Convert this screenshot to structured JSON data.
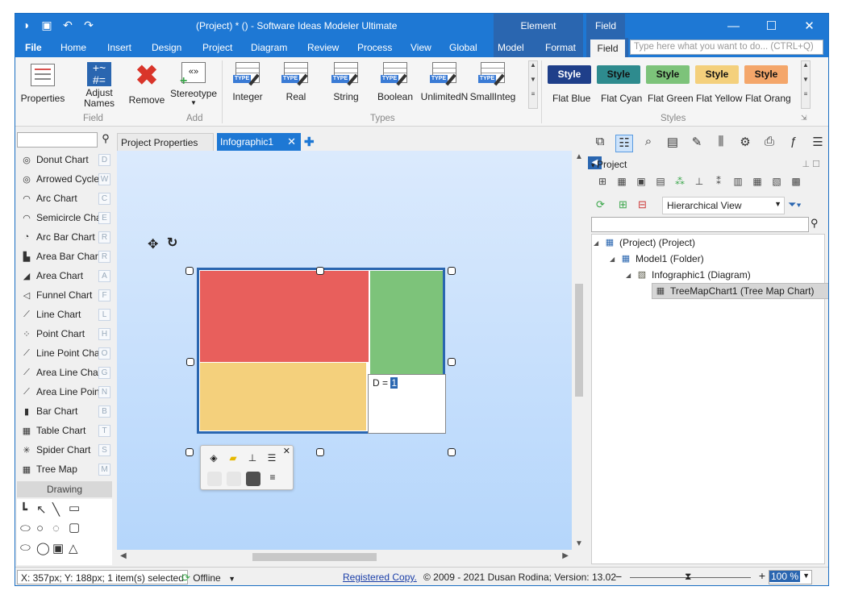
{
  "window": {
    "title": "(Project) *  () - Software Ideas Modeler Ultimate",
    "context_element": "Element",
    "context_field": "Field",
    "minimize": "—",
    "maximize": "☐",
    "close": "✕"
  },
  "menu": {
    "file": "File",
    "items": [
      "Home",
      "Insert",
      "Design",
      "Project",
      "Diagram",
      "Review",
      "Process",
      "View",
      "Global",
      "Model",
      "Format",
      "Field"
    ],
    "search_placeholder": "Type here what you want to do...  (CTRL+Q)"
  },
  "ribbon": {
    "properties": "Properties",
    "adjust_names": "Adjust Names",
    "remove": "Remove",
    "stereotype": "Stereotype",
    "group_field": "Field",
    "group_add": "Add",
    "group_types": "Types",
    "group_styles": "Styles",
    "types": [
      "Integer",
      "Real",
      "String",
      "Boolean",
      "UnlimitedN",
      "SmallInteg"
    ],
    "type_tag": "TYPE",
    "style_btn": "Style",
    "styles": [
      {
        "label": "Flat Blue",
        "bg": "#1f3f8a",
        "fg": "#ffffff"
      },
      {
        "label": "Flat Cyan",
        "bg": "#2e8b8e",
        "fg": "#111111"
      },
      {
        "label": "Flat Green",
        "bg": "#7dc37a",
        "fg": "#111111"
      },
      {
        "label": "Flat Yellow",
        "bg": "#f4d07c",
        "fg": "#111111"
      },
      {
        "label": "Flat Orang",
        "bg": "#f4a66a",
        "fg": "#111111"
      }
    ]
  },
  "toolbox": {
    "items": [
      {
        "label": "Donut Chart",
        "key": "D",
        "icon": "◎"
      },
      {
        "label": "Arrowed Cycle",
        "key": "W",
        "icon": "◎"
      },
      {
        "label": "Arc Chart",
        "key": "C",
        "icon": "◠"
      },
      {
        "label": "Semicircle Chart",
        "key": "E",
        "icon": "◠"
      },
      {
        "label": "Arc Bar Chart",
        "key": "R",
        "icon": "◔"
      },
      {
        "label": "Area Bar Chart",
        "key": "R",
        "icon": "▙"
      },
      {
        "label": "Area Chart",
        "key": "A",
        "icon": "◢"
      },
      {
        "label": "Funnel Chart",
        "key": "F",
        "icon": "◁"
      },
      {
        "label": "Line Chart",
        "key": "L",
        "icon": "⟋"
      },
      {
        "label": "Point Chart",
        "key": "H",
        "icon": "⁘"
      },
      {
        "label": "Line Point Chart",
        "key": "O",
        "icon": "⟋"
      },
      {
        "label": "Area Line Chart",
        "key": "G",
        "icon": "⟋"
      },
      {
        "label": "Area Line Point",
        "key": "N",
        "icon": "⟋"
      },
      {
        "label": "Bar Chart",
        "key": "B",
        "icon": "▮"
      },
      {
        "label": "Table Chart",
        "key": "T",
        "icon": "▦"
      },
      {
        "label": "Spider Chart",
        "key": "S",
        "icon": "✳"
      },
      {
        "label": "Tree Map",
        "key": "M",
        "icon": "▦"
      }
    ],
    "drawing_header": "Drawing"
  },
  "tabs": {
    "project_properties": "Project Properties",
    "infographic": "Infographic1"
  },
  "canvas": {
    "edit_prefix": "D = ",
    "edit_value": "1"
  },
  "project_panel": {
    "header": "Project",
    "view": "Hierarchical View",
    "tree": [
      {
        "label": "(Project) (Project)",
        "level": 0,
        "icon": "▦"
      },
      {
        "label": "Model1 (Folder)",
        "level": 1,
        "icon": "▦"
      },
      {
        "label": "Infographic1 (Diagram)",
        "level": 2,
        "icon": "▧"
      },
      {
        "label": "TreeMapChart1 (Tree Map Chart)",
        "level": 3,
        "icon": "▦"
      }
    ]
  },
  "status": {
    "coords": "X: 357px; Y: 188px; 1 item(s) selected",
    "offline": "Offline",
    "registered": "Registered Copy.",
    "copyright": "© 2009 - 2021 Dusan Rodina; Version: 13.02",
    "zoom": "100 %"
  }
}
